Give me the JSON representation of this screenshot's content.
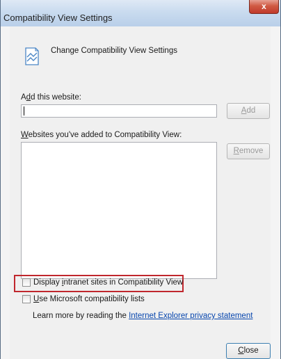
{
  "window": {
    "title": "Compatibility View Settings",
    "close_glyph": "x"
  },
  "header": {
    "icon": "compatibility-view-icon",
    "text": "Change Compatibility View Settings"
  },
  "add_website": {
    "label_pre": "A",
    "label_key": "d",
    "label_post": "d this website:",
    "value": "",
    "button_key": "A",
    "button_post": "dd"
  },
  "websites_list": {
    "label_key": "W",
    "label_post": "ebsites you've added to Compatibility View:",
    "items": [],
    "remove_key": "R",
    "remove_post": "emove"
  },
  "options": {
    "intranet_pre": "Display ",
    "intranet_key": "i",
    "intranet_post": "ntranet sites in Compatibility View",
    "intranet_checked": false,
    "ms_key": "U",
    "ms_post": "se Microsoft compatibility lists",
    "ms_checked": false
  },
  "learn_more": {
    "text": "Learn more by reading the ",
    "link": "Internet Explorer privacy statement"
  },
  "footer": {
    "close_key": "C",
    "close_post": "lose"
  },
  "colors": {
    "highlight": "#c0272d",
    "link": "#0645ad"
  }
}
